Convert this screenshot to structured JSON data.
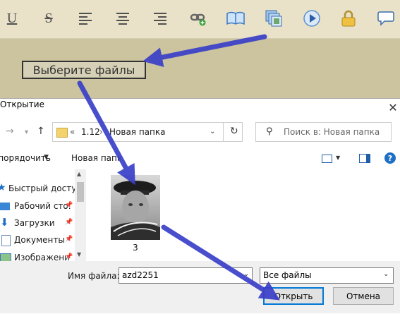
{
  "toolbar": {
    "underline_glyph": "U",
    "strike_glyph": "S"
  },
  "editor": {
    "choose_files_label": "Выберите файлы"
  },
  "dialog": {
    "title": "Открытие",
    "breadcrumb_overflow": "«",
    "breadcrumb_parent": "1.12",
    "breadcrumb_sep": "›",
    "breadcrumb_current": "Новая папка",
    "search_placeholder": "Поиск в: Новая папка",
    "organize_label": "Упорядочить",
    "new_folder_label": "Новая папка",
    "help_glyph": "?",
    "tree": [
      {
        "label": "Быстрый доступ"
      },
      {
        "label": "Рабочий сто."
      },
      {
        "label": "Загрузки"
      },
      {
        "label": "Документы"
      },
      {
        "label": "Изображени"
      }
    ],
    "file": {
      "name": "3"
    },
    "filename_label": "Имя файла:",
    "filename_value": "azd2251",
    "filter_value": "Все файлы",
    "open_label": "Открыть",
    "cancel_label": "Отмена"
  },
  "colors": {
    "toolbar_bg": "#e9e2c8",
    "editor_bg": "#cbc49f",
    "annotation_arrow": "#3a3fc8",
    "accent_blue": "#0078d7"
  },
  "icons": [
    "underline-icon",
    "strikethrough-icon",
    "align-left-icon",
    "align-center-icon",
    "align-right-icon",
    "link-add-icon",
    "book-icon",
    "gallery-icon",
    "play-icon",
    "lock-icon",
    "speech-bubble-icon"
  ]
}
